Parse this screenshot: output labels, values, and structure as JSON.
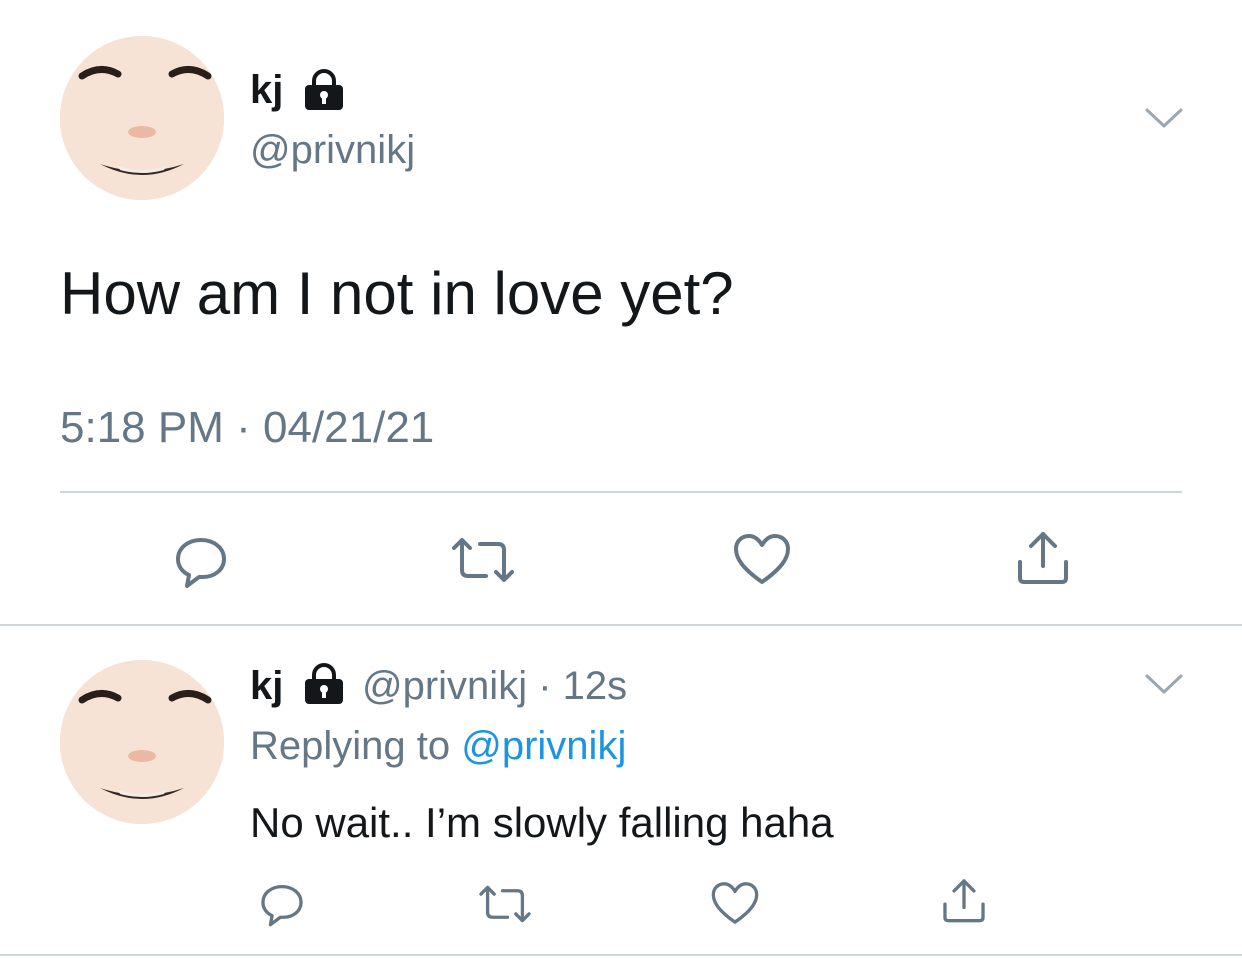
{
  "main_tweet": {
    "display_name": "kj",
    "handle": "@privnikj",
    "text": "How am I not in love yet?",
    "time": "5:18 PM",
    "separator": "·",
    "date": "04/21/21",
    "icons": {
      "protected": "lock-icon",
      "menu": "chevron-down-icon",
      "reply": "reply-icon",
      "retweet": "retweet-icon",
      "like": "heart-icon",
      "share": "share-icon"
    }
  },
  "reply_tweet": {
    "display_name": "kj",
    "handle": "@privnikj",
    "separator": "·",
    "age": "12s",
    "replying_label": "Replying to",
    "replying_mention": "@privnikj",
    "text": "No wait.. I’m slowly falling haha"
  },
  "colors": {
    "text_primary": "#14171a",
    "text_secondary": "#657786",
    "accent": "#1b95e0",
    "divider": "#ccd6dd",
    "icon": "#657786"
  }
}
